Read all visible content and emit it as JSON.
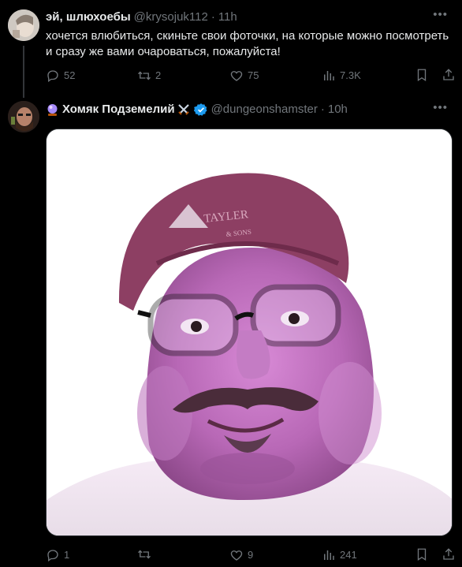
{
  "tweet1": {
    "name": "эй, шлюхоебы",
    "handle": "@krysojuk112",
    "sep": "·",
    "time": "11h",
    "text_line1": "хочется влюбиться, скиньте свои фоточки, на которые можно посмотреть",
    "text_line2": "и сразу же вами очароваться, пожалуйста!",
    "replies": "52",
    "reposts": "2",
    "likes": "75",
    "views": "7.3K"
  },
  "tweet2": {
    "name": "Хомяк Подземелий",
    "handle": "@dungeonshamster",
    "sep": "·",
    "time": "10h",
    "cap_text": "TAYLER",
    "cap_text2": "& SONS",
    "replies": "1",
    "reposts": "",
    "likes": "9",
    "views": "241"
  },
  "colors": {
    "background": "#000000",
    "text": "#e7e9ea",
    "muted": "#71767b",
    "verified": "#1d9bf0"
  }
}
